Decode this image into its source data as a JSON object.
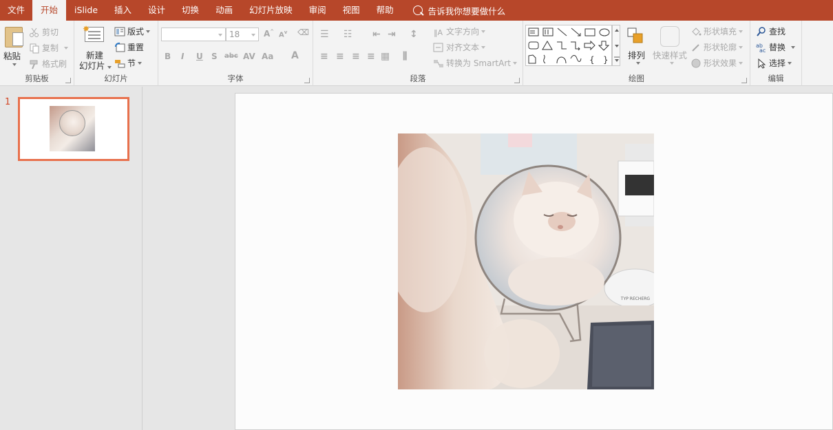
{
  "menubar": {
    "tabs": [
      "文件",
      "开始",
      "iSlide",
      "插入",
      "设计",
      "切换",
      "动画",
      "幻灯片放映",
      "审阅",
      "视图",
      "帮助"
    ],
    "active_tab": "开始",
    "tell_me": "告诉我你想要做什么",
    "accent": "#b7472a"
  },
  "ribbon": {
    "clipboard": {
      "label": "剪贴板",
      "paste": "粘贴",
      "cut": "剪切",
      "copy": "复制",
      "format_painter": "格式刷"
    },
    "slides": {
      "label": "幻灯片",
      "new_slide_line1": "新建",
      "new_slide_line2": "幻灯片",
      "layout": "版式",
      "reset": "重置",
      "section": "节"
    },
    "font": {
      "label": "字体",
      "font_name": "",
      "font_size": "18"
    },
    "paragraph": {
      "label": "段落",
      "text_direction": "文字方向",
      "align_text": "对齐文本",
      "convert_smartart": "转换为 SmartArt"
    },
    "drawing": {
      "label": "绘图",
      "arrange": "排列",
      "quick_styles": "快速样式",
      "shape_fill": "形状填充",
      "shape_outline": "形状轮廓",
      "shape_effects": "形状效果"
    },
    "editing": {
      "label": "编辑",
      "find": "查找",
      "replace": "替换",
      "select": "选择"
    }
  },
  "thumbnails": {
    "slide_number": "1",
    "selected_border": "#e8704c"
  }
}
